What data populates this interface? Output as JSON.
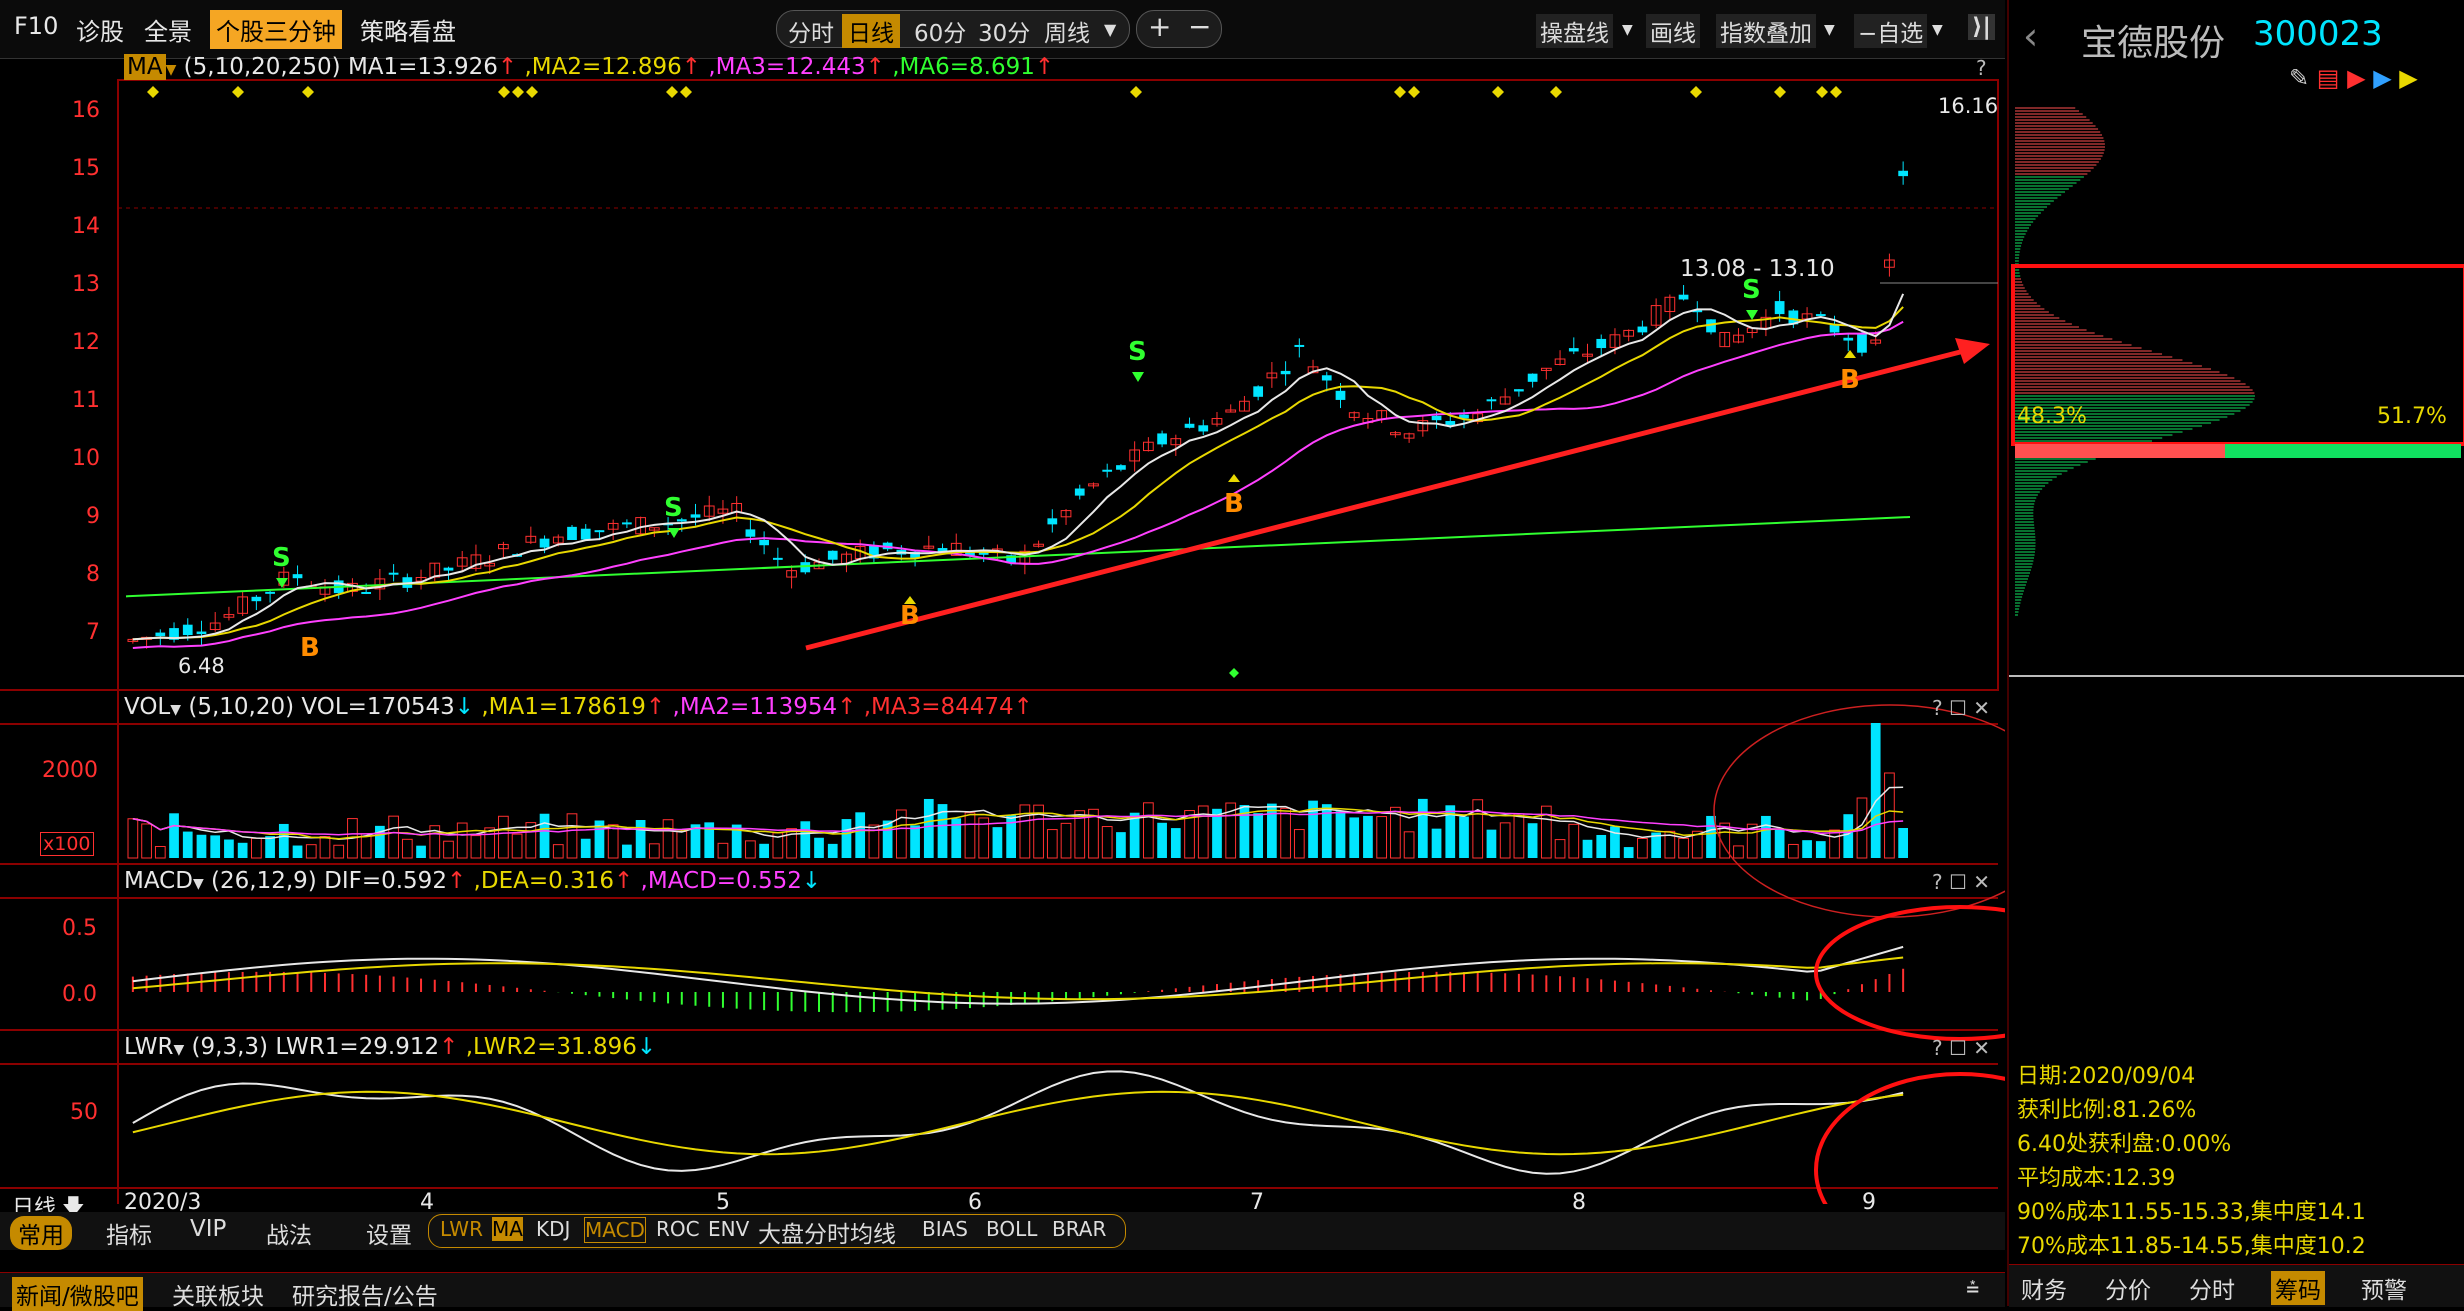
{
  "toolbar": {
    "f10": "F10",
    "diagnose": "诊股",
    "overview": "全景",
    "stock3min": "个股三分钟",
    "strategy": "策略看盘",
    "periods": [
      "分时",
      "日线",
      "60分",
      "30分",
      "周线"
    ],
    "active_period": "日线",
    "zoom_in": "+",
    "zoom_out": "−",
    "op_line": "操盘线",
    "draw": "画线",
    "index_overlay": "指数叠加",
    "watchlist": "−自选",
    "collapse": "⟩|"
  },
  "main": {
    "ma_label": "MA",
    "ma_params": "(5,10,20,250)",
    "ma1": "MA1=13.926",
    "ma2": ",MA2=12.896",
    "ma3": ",MA3=12.443",
    "ma6": ",MA6=8.691",
    "high_label": "16.16",
    "low_label": "6.48",
    "range_label": "13.08 - 13.10",
    "y_ticks": [
      "16",
      "15",
      "14",
      "13",
      "12",
      "11",
      "10",
      "9",
      "8",
      "7"
    ],
    "signals": [
      "S",
      "S",
      "S",
      "S",
      "B",
      "B",
      "B",
      "B"
    ]
  },
  "vol": {
    "label": "VOL",
    "params": "(5,10,20)",
    "vol": "VOL=170543",
    "ma1": ",MA1=178619",
    "ma2": ",MA2=113954",
    "ma3": ",MA3=84474",
    "tick": "2000",
    "unit": "x100"
  },
  "macd": {
    "label": "MACD",
    "params": "(26,12,9)",
    "dif": "DIF=0.592",
    "dea": ",DEA=0.316",
    "macd": ",MACD=0.552",
    "ticks": [
      "0.5",
      "0.0"
    ]
  },
  "lwr": {
    "label": "LWR",
    "params": "(9,3,3)",
    "lwr1": "LWR1=29.912",
    "lwr2": ",LWR2=31.896",
    "tick": "50"
  },
  "dates": {
    "period": "日线",
    "labels": [
      "2020/3",
      "4",
      "5",
      "6",
      "7",
      "8",
      "9"
    ]
  },
  "bottom_tabs": {
    "common": "常用",
    "indicator": "指标",
    "vip": "VIP",
    "tactics": "战法",
    "settings": "设置",
    "items": [
      "LWR",
      "MA",
      "KDJ",
      "MACD",
      "ROC",
      "ENV",
      "大盘分时均线",
      "BIAS",
      "BOLL",
      "BRAR"
    ],
    "active": [
      "LWR",
      "MA",
      "MACD"
    ]
  },
  "news_bar": {
    "tabs": [
      "新闻/微股吧",
      "关联板块",
      "研究报告/公告"
    ]
  },
  "right": {
    "back": "‹",
    "stock_name": "宝德股份",
    "stock_code": "300023",
    "pct_left": "48.3%",
    "pct_right": "51.7%",
    "info": [
      "日期:2020/09/04",
      "获利比例:81.26%",
      "6.40处获利盘:0.00%",
      "平均成本:12.39",
      "90%成本11.55-15.33,集中度14.1",
      "70%成本11.85-14.55,集中度10.2"
    ],
    "tabs": [
      "财务",
      "分价",
      "分时",
      "筹码",
      "预警"
    ],
    "active_tab": "筹码"
  },
  "colors": {
    "up": "#ff3030",
    "down": "#00e5ff",
    "ma5": "#e8e8e8",
    "ma10": "#e8d800",
    "ma20": "#ff40ff",
    "ma250": "#30ff30",
    "highlight": "#f5a623"
  }
}
